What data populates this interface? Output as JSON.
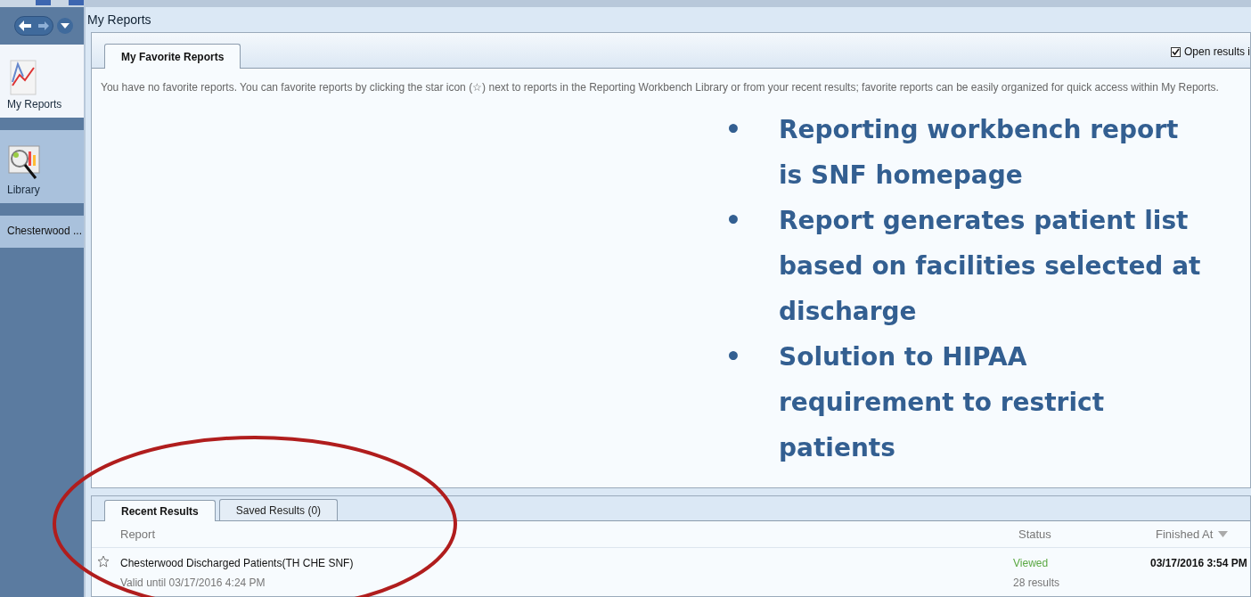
{
  "sidebar": {
    "items": [
      {
        "label": "My Reports",
        "kind": "reports",
        "selected": true
      },
      {
        "label": "Library",
        "kind": "library",
        "selected": false
      },
      {
        "label": "Chesterwood ...",
        "kind": "text",
        "selected": false
      }
    ]
  },
  "window": {
    "title": "My Reports"
  },
  "favorites": {
    "tabs": [
      {
        "label": "My Favorite Reports",
        "selected": true
      }
    ],
    "open_results": {
      "label": "Open results i",
      "checked": true
    },
    "message": "You have no favorite reports. You can favorite reports by clicking the star icon (☆) next to reports in the Reporting Workbench Library or from your recent results; favorite reports can be easily organized for quick access within My Reports."
  },
  "annotation": {
    "bullets": [
      {
        "marker": "•",
        "text": "Reporting workbench report is SNF homepage"
      },
      {
        "marker": "•",
        "text": "Report generates patient list based on facilities selected at discharge"
      },
      {
        "marker": "•",
        "text": "Solution to HIPAA requirement to restrict patients"
      }
    ]
  },
  "results": {
    "tabs": [
      {
        "label": "Recent Results",
        "selected": true
      },
      {
        "label": "Saved Results (0)",
        "selected": false
      }
    ],
    "columns": [
      "Report",
      "Status",
      "Finished At"
    ],
    "rows": [
      {
        "name": "Chesterwood Discharged Patients(TH CHE SNF)",
        "valid": "Valid until 03/17/2016 4:24 PM",
        "status": "Viewed",
        "count": "28 results",
        "finished": "03/17/2016 3:54 PM",
        "favorite": false
      }
    ]
  }
}
